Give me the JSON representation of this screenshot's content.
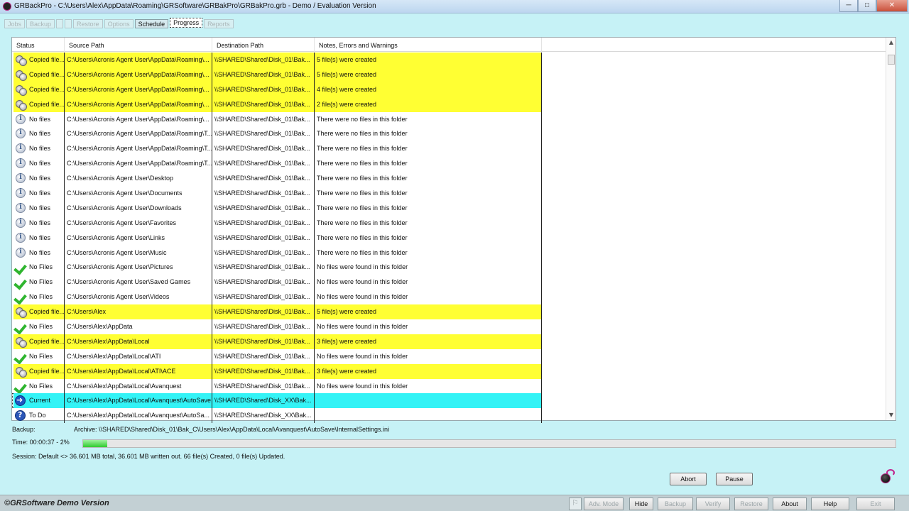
{
  "window": {
    "title": "GRBackPro - C:\\Users\\Alex\\AppData\\Roaming\\GRSoftware\\GRBakPro\\GRBakPro.grb - Demo / Evaluation Version",
    "minimize": "─",
    "maximize": "□",
    "close": "✕"
  },
  "tabs": [
    {
      "label": "Jobs",
      "state": "disabled"
    },
    {
      "label": "Backup",
      "state": "disabled"
    },
    {
      "label": "",
      "state": "disabled"
    },
    {
      "label": "",
      "state": "disabled"
    },
    {
      "label": "Restore",
      "state": "disabled"
    },
    {
      "label": "Options",
      "state": "disabled"
    },
    {
      "label": "Schedule",
      "state": "enabled"
    },
    {
      "label": "Progress",
      "state": "active"
    },
    {
      "label": "Reports",
      "state": "disabled"
    }
  ],
  "table": {
    "columns": [
      "Status",
      "Source Path",
      "Destination Path",
      "Notes, Errors and Warnings"
    ],
    "rows": [
      {
        "icon": "copied",
        "hl": "yellow",
        "status": "Copied file...",
        "src": "C:\\Users\\Acronis Agent User\\AppData\\Roaming\\...",
        "dst": "\\\\SHARED\\Shared\\Disk_01\\Bak...",
        "notes": "5 file(s) were created"
      },
      {
        "icon": "copied",
        "hl": "yellow",
        "status": "Copied file...",
        "src": "C:\\Users\\Acronis Agent User\\AppData\\Roaming\\...",
        "dst": "\\\\SHARED\\Shared\\Disk_01\\Bak...",
        "notes": "5 file(s) were created"
      },
      {
        "icon": "copied",
        "hl": "yellow",
        "status": "Copied file...",
        "src": "C:\\Users\\Acronis Agent User\\AppData\\Roaming\\...",
        "dst": "\\\\SHARED\\Shared\\Disk_01\\Bak...",
        "notes": "4 file(s) were created"
      },
      {
        "icon": "copied",
        "hl": "yellow",
        "status": "Copied file...",
        "src": "C:\\Users\\Acronis Agent User\\AppData\\Roaming\\...",
        "dst": "\\\\SHARED\\Shared\\Disk_01\\Bak...",
        "notes": "2 file(s) were created"
      },
      {
        "icon": "info",
        "hl": "",
        "status": "No files",
        "src": "C:\\Users\\Acronis Agent User\\AppData\\Roaming\\...",
        "dst": "\\\\SHARED\\Shared\\Disk_01\\Bak...",
        "notes": "There were no files in this folder"
      },
      {
        "icon": "info",
        "hl": "",
        "status": "No files",
        "src": "C:\\Users\\Acronis Agent User\\AppData\\Roaming\\T...",
        "dst": "\\\\SHARED\\Shared\\Disk_01\\Bak...",
        "notes": "There were no files in this folder"
      },
      {
        "icon": "info",
        "hl": "",
        "status": "No files",
        "src": "C:\\Users\\Acronis Agent User\\AppData\\Roaming\\T...",
        "dst": "\\\\SHARED\\Shared\\Disk_01\\Bak...",
        "notes": "There were no files in this folder"
      },
      {
        "icon": "info",
        "hl": "",
        "status": "No files",
        "src": "C:\\Users\\Acronis Agent User\\AppData\\Roaming\\T...",
        "dst": "\\\\SHARED\\Shared\\Disk_01\\Bak...",
        "notes": "There were no files in this folder"
      },
      {
        "icon": "info",
        "hl": "",
        "status": "No files",
        "src": "C:\\Users\\Acronis Agent User\\Desktop",
        "dst": "\\\\SHARED\\Shared\\Disk_01\\Bak...",
        "notes": "There were no files in this folder"
      },
      {
        "icon": "info",
        "hl": "",
        "status": "No files",
        "src": "C:\\Users\\Acronis Agent User\\Documents",
        "dst": "\\\\SHARED\\Shared\\Disk_01\\Bak...",
        "notes": "There were no files in this folder"
      },
      {
        "icon": "info",
        "hl": "",
        "status": "No files",
        "src": "C:\\Users\\Acronis Agent User\\Downloads",
        "dst": "\\\\SHARED\\Shared\\Disk_01\\Bak...",
        "notes": "There were no files in this folder"
      },
      {
        "icon": "info",
        "hl": "",
        "status": "No files",
        "src": "C:\\Users\\Acronis Agent User\\Favorites",
        "dst": "\\\\SHARED\\Shared\\Disk_01\\Bak...",
        "notes": "There were no files in this folder"
      },
      {
        "icon": "info",
        "hl": "",
        "status": "No files",
        "src": "C:\\Users\\Acronis Agent User\\Links",
        "dst": "\\\\SHARED\\Shared\\Disk_01\\Bak...",
        "notes": "There were no files in this folder"
      },
      {
        "icon": "info",
        "hl": "",
        "status": "No files",
        "src": "C:\\Users\\Acronis Agent User\\Music",
        "dst": "\\\\SHARED\\Shared\\Disk_01\\Bak...",
        "notes": "There were no files in this folder"
      },
      {
        "icon": "check",
        "hl": "",
        "status": "No Files",
        "src": "C:\\Users\\Acronis Agent User\\Pictures",
        "dst": "\\\\SHARED\\Shared\\Disk_01\\Bak...",
        "notes": "No files were found in this folder"
      },
      {
        "icon": "check",
        "hl": "",
        "status": "No Files",
        "src": "C:\\Users\\Acronis Agent User\\Saved Games",
        "dst": "\\\\SHARED\\Shared\\Disk_01\\Bak...",
        "notes": "No files were found in this folder"
      },
      {
        "icon": "check",
        "hl": "",
        "status": "No Files",
        "src": "C:\\Users\\Acronis Agent User\\Videos",
        "dst": "\\\\SHARED\\Shared\\Disk_01\\Bak...",
        "notes": "No files were found in this folder"
      },
      {
        "icon": "copied",
        "hl": "yellow",
        "status": "Copied file...",
        "src": "C:\\Users\\Alex",
        "dst": "\\\\SHARED\\Shared\\Disk_01\\Bak...",
        "notes": "5 file(s) were created"
      },
      {
        "icon": "check",
        "hl": "",
        "status": "No Files",
        "src": "C:\\Users\\Alex\\AppData",
        "dst": "\\\\SHARED\\Shared\\Disk_01\\Bak...",
        "notes": "No files were found in this folder"
      },
      {
        "icon": "copied",
        "hl": "yellow",
        "status": "Copied file...",
        "src": "C:\\Users\\Alex\\AppData\\Local",
        "dst": "\\\\SHARED\\Shared\\Disk_01\\Bak...",
        "notes": "3 file(s) were created"
      },
      {
        "icon": "check",
        "hl": "",
        "status": "No Files",
        "src": "C:\\Users\\Alex\\AppData\\Local\\ATI",
        "dst": "\\\\SHARED\\Shared\\Disk_01\\Bak...",
        "notes": "No files were found in this folder"
      },
      {
        "icon": "copied",
        "hl": "yellow",
        "status": "Copied file...",
        "src": "C:\\Users\\Alex\\AppData\\Local\\ATI\\ACE",
        "dst": "\\\\SHARED\\Shared\\Disk_01\\Bak...",
        "notes": "3 file(s) were created"
      },
      {
        "icon": "check",
        "hl": "",
        "status": "No Files",
        "src": "C:\\Users\\Alex\\AppData\\Local\\Avanquest",
        "dst": "\\\\SHARED\\Shared\\Disk_01\\Bak...",
        "notes": "No files were found in this folder"
      },
      {
        "icon": "current",
        "hl": "cyan",
        "status": "Current",
        "src": "C:\\Users\\Alex\\AppData\\Local\\Avanquest\\AutoSave",
        "dst": "\\\\SHARED\\Shared\\Disk_XX\\Bak...",
        "notes": ""
      },
      {
        "icon": "todo",
        "hl": "",
        "status": "To Do",
        "src": "C:\\Users\\Alex\\AppData\\Local\\Avanquest\\AutoSa...",
        "dst": "\\\\SHARED\\Shared\\Disk_XX\\Bak...",
        "notes": ""
      }
    ]
  },
  "status": {
    "backup_label": "Backup:",
    "archive_text": "Archive:  \\\\SHARED\\Shared\\Disk_01\\Bak_C\\Users\\Alex\\AppData\\Local\\Avanquest\\AutoSave\\InternalSettings.ini",
    "time_text": "Time:  00:00:37 - 2%",
    "progress_percent": 3,
    "session_text": "Session:  Default <> 36.601 MB total,  36.601 MB written out. 66 file(s) Created, 0 file(s) Updated."
  },
  "actions": {
    "abort": "Abort",
    "pause": "Pause"
  },
  "footer": {
    "brand": "©GRSoftware Demo Version",
    "buttons": [
      {
        "label": "Adv. Mode",
        "enabled": false
      },
      {
        "label": "Hide",
        "enabled": true
      },
      {
        "label": "Backup",
        "enabled": false
      },
      {
        "label": "Verify",
        "enabled": false
      },
      {
        "label": "Restore",
        "enabled": false
      },
      {
        "label": "About",
        "enabled": true
      },
      {
        "label": "Help",
        "enabled": true
      },
      {
        "label": "Exit",
        "enabled": false
      }
    ]
  },
  "colors": {
    "background": "#c6f2f6",
    "highlight_copied": "#ffff33",
    "highlight_current": "#33f3f6"
  }
}
